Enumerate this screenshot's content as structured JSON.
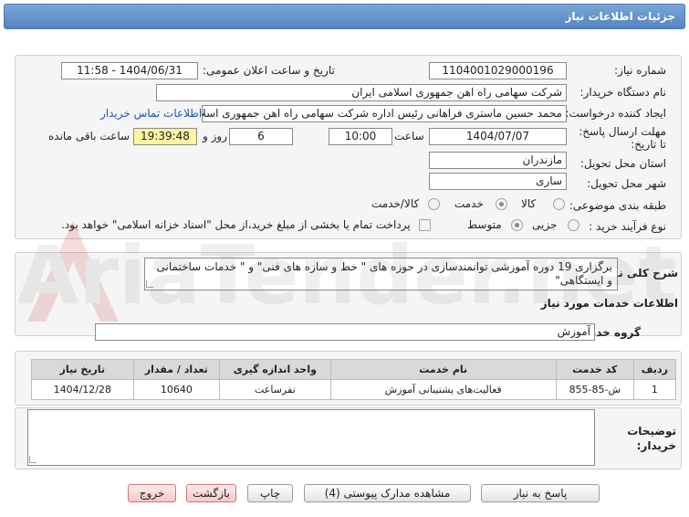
{
  "header": {
    "title": "جزئیات اطلاعات نیاز"
  },
  "form": {
    "need_number_label": "شماره نیاز:",
    "need_number": "1104001029000196",
    "announce_label": "تاریخ و ساعت اعلان عمومی:",
    "announce_value": "1404/06/31 - 11:58",
    "buyer_org_label": "نام دستگاه خریدار:",
    "buyer_org": "شرکت سهامی راه اهن جمهوری اسلامی ایران",
    "requester_label": "ایجاد کننده درخواست:",
    "requester": "محمد حسین ماستری فراهانی رئیس اداره شرکت سهامی راه اهن جمهوری اسلامی ایران",
    "contact_link": "اطلاعات تماس خریدار",
    "deadline_label": "مهلت ارسال پاسخ: تا تاریخ:",
    "deadline_date": "1404/07/07",
    "time_label": "ساعت",
    "deadline_time": "10:00",
    "days_value": "6",
    "days_label": "روز و",
    "remaining_time": "19:39:48",
    "remaining_label": "ساعت باقی مانده",
    "province_label": "استان محل تحویل:",
    "province": "مازندران",
    "city_label": "شهر محل تحویل:",
    "city": "ساری",
    "category_label": "طبقه بندی موضوعی:",
    "category_options": [
      "کالا",
      "خدمت",
      "کالا/خدمت"
    ],
    "category_selected": "خدمت",
    "process_label": "نوع فرآیند خرید :",
    "process_options": [
      "جزیی",
      "متوسط"
    ],
    "process_selected": "متوسط",
    "payment_note": "پرداخت تمام یا بخشی از مبلغ خرید،از محل \"اسناد خزانه اسلامی\" خواهد بود."
  },
  "description": {
    "label": "شرح کلی نیاز:",
    "text": "برگزاری 19 دوره آموزشی توانمندسازی در حوزه های \" خط و سازه های فنی\" و \" خدمات ساختمانی و ایستگاهی\""
  },
  "services": {
    "section_title": "اطلاعات خدمات مورد نیاز",
    "group_label": "گروه خدمت:",
    "group_value": "آموزش",
    "columns": [
      "ردیف",
      "کد خدمت",
      "نام خدمت",
      "واحد اندازه گیری",
      "تعداد / مقدار",
      "تاریخ نیاز"
    ],
    "rows": [
      {
        "row": "1",
        "code": "ش-85-855",
        "name": "فعالیت‌های پشتیبانی آموزش",
        "unit": "نفرساعت",
        "qty": "10640",
        "date": "1404/12/28"
      }
    ]
  },
  "buyer_notes": {
    "label": "توضیحات خریدار:",
    "value": ""
  },
  "buttons": {
    "reply": "پاسخ به نیاز",
    "attachments": "مشاهده مدارک پیوستی (4)",
    "print": "چاپ",
    "back": "بازگشت",
    "exit": "خروج"
  },
  "watermark": {
    "text": "AriaTender.net"
  },
  "colors": {
    "header": "#5f8fc9",
    "link": "#1a55b8",
    "remaining_bg": "#fff5a0"
  }
}
